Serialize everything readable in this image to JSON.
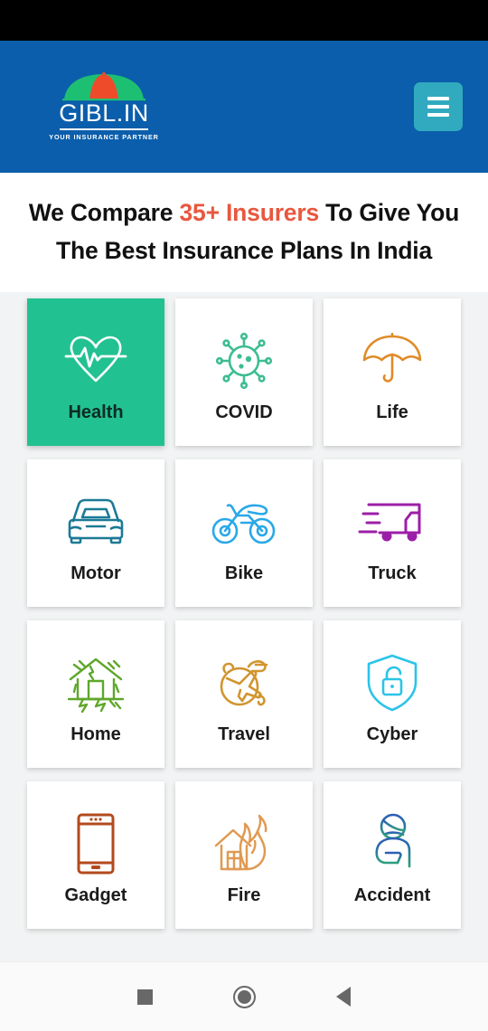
{
  "status_bar": {
    "visible": true,
    "background": "#000000"
  },
  "header": {
    "background": "#0B5EAB",
    "logo": {
      "wordmark": "GIBL.IN",
      "tagline": "YOUR INSURANCE PARTNER",
      "icon": "umbrella-logo-icon",
      "umbrella_canopy_color": "#1DBF73",
      "umbrella_center_color": "#EE4B2B"
    },
    "menu_button": {
      "icon": "hamburger-menu-icon",
      "background": "#31AABF",
      "bar_color": "#FFFFFF"
    }
  },
  "headline": {
    "line1_part1": "We Compare ",
    "line1_accent": "35+ Insurers",
    "line1_part2": " To Give You",
    "line2": "The Best Insurance Plans In India",
    "accent_color": "#E8573F",
    "text_color": "#111111"
  },
  "grid": {
    "background": "#F1F3F4",
    "active_card_color": "#22C191",
    "cards": [
      {
        "label": "Health",
        "icon": "heart-pulse-icon",
        "color": "#FFFFFF",
        "active": true
      },
      {
        "label": "COVID",
        "icon": "virus-icon",
        "color": "#3EBD93",
        "active": false
      },
      {
        "label": "Life",
        "icon": "umbrella-icon",
        "color": "#E08B28",
        "active": false
      },
      {
        "label": "Motor",
        "icon": "car-icon",
        "color": "#1B7A96",
        "active": false
      },
      {
        "label": "Bike",
        "icon": "motorcycle-icon",
        "color": "#29A8E8",
        "active": false
      },
      {
        "label": "Truck",
        "icon": "truck-icon",
        "color": "#9C1FA8",
        "active": false
      },
      {
        "label": "Home",
        "icon": "damaged-house-icon",
        "color": "#5FA72B",
        "active": false
      },
      {
        "label": "Travel",
        "icon": "airplane-globe-icon",
        "color": "#D1952F",
        "active": false
      },
      {
        "label": "Cyber",
        "icon": "shield-lock-icon",
        "color": "#2BC4E8",
        "active": false
      },
      {
        "label": "Gadget",
        "icon": "smartphone-icon",
        "color": "#B34A1E",
        "active": false
      },
      {
        "label": "Fire",
        "icon": "house-fire-icon",
        "color": "#E09A52",
        "active": false
      },
      {
        "label": "Accident",
        "icon": "injured-person-icon",
        "color": "#2B5FB5",
        "active": false
      }
    ]
  },
  "nav_bar": {
    "background": "#FAFAFA",
    "icon_color": "#686868",
    "buttons": [
      {
        "name": "recents",
        "icon": "square-icon"
      },
      {
        "name": "home",
        "icon": "circle-icon"
      },
      {
        "name": "back",
        "icon": "triangle-left-icon"
      }
    ]
  }
}
